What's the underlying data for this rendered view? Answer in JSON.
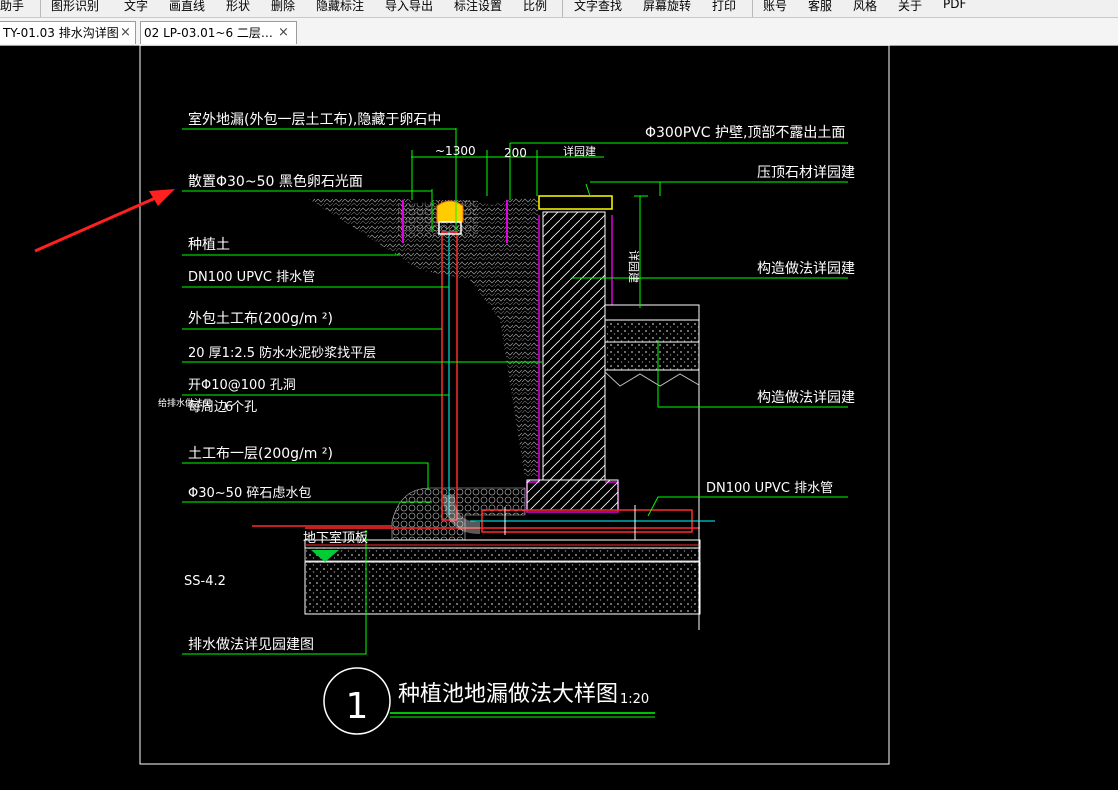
{
  "menu": {
    "items": [
      "助手",
      "图形识别",
      "文字",
      "画直线",
      "形状",
      "删除",
      "隐藏标注",
      "导入导出",
      "标注设置",
      "比例",
      "文字查找",
      "屏幕旋转",
      "打印",
      "账号",
      "客服",
      "风格",
      "关于",
      "PDF"
    ]
  },
  "tabs": [
    {
      "label": "TY-01.03 排水沟详图",
      "close": "×"
    },
    {
      "label": "02 LP-03.01~6 二层…",
      "close": "×"
    }
  ],
  "drawing": {
    "labels": {
      "outdoor_drain": "室外地漏(外包一层土工布),隐藏于卵石中",
      "pebbles": "散置Φ30~50   黑色卵石光面",
      "soil": "种植土",
      "pipe_top": "DN100    UPVC  排水管",
      "geotextile_wrap": "外包土工布(200g/m   ²)",
      "mortar_layer": "20 厚1:2.5 防水水泥砂浆找平层",
      "holes_1": "开Φ10@100    孔洞",
      "holes_2": "每周边 个孔",
      "side_note": "给排水做法见",
      "geotextile_layer": "土工布一层(200g/m   ²)",
      "gravel_pack": "Φ30~50    碎石虑水包",
      "roof_slab": "地下室顶板",
      "ss_code": "SS-4.2",
      "drainage_ref": "排水做法详见园建图",
      "pvc_pipe": "Φ300PVC   护壁,顶部不露出土面",
      "coping": "压顶石材详园建",
      "structure_1": "构造做法详园建",
      "structure_2": "构造做法详园建",
      "pipe_bottom": "DN100    UPVC  排水管",
      "dim_1300": "~1300",
      "dim_200": "200",
      "dim_landscape": "详园建",
      "dim_vertical": "详园建",
      "num_6": "6"
    },
    "title": {
      "number": "1",
      "text": "种植池地漏做法大样图",
      "scale": "1:20"
    }
  },
  "colors": {
    "background": "#000000",
    "line_white": "#ffffff",
    "line_green": "#00ff00",
    "line_red": "#ff2a2a",
    "line_magenta": "#e000e0",
    "line_yellow": "#ffff00",
    "line_cyan": "#00ffff",
    "arrow_red": "#ff2020"
  }
}
